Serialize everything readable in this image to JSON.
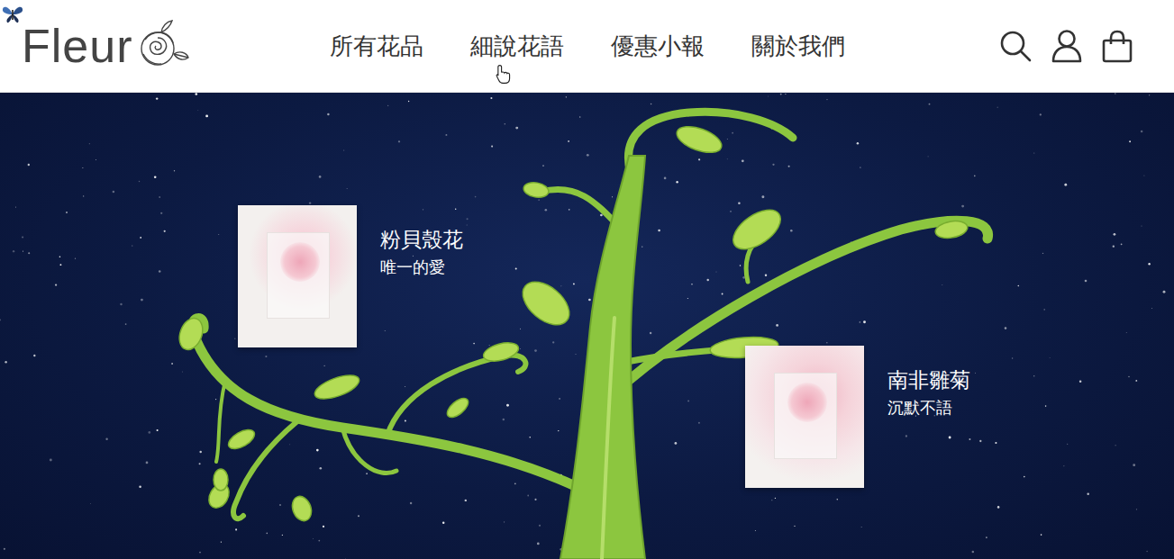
{
  "logo": {
    "text": "Fleur"
  },
  "nav": [
    {
      "label": "所有花品",
      "hovered": false
    },
    {
      "label": "細說花語",
      "hovered": true
    },
    {
      "label": "優惠小報",
      "hovered": false
    },
    {
      "label": "關於我們",
      "hovered": false
    }
  ],
  "hero": {
    "flowers": [
      {
        "name": "粉貝殼花",
        "meaning": "唯一的愛"
      },
      {
        "name": "南非雛菊",
        "meaning": "沉默不語"
      }
    ]
  }
}
